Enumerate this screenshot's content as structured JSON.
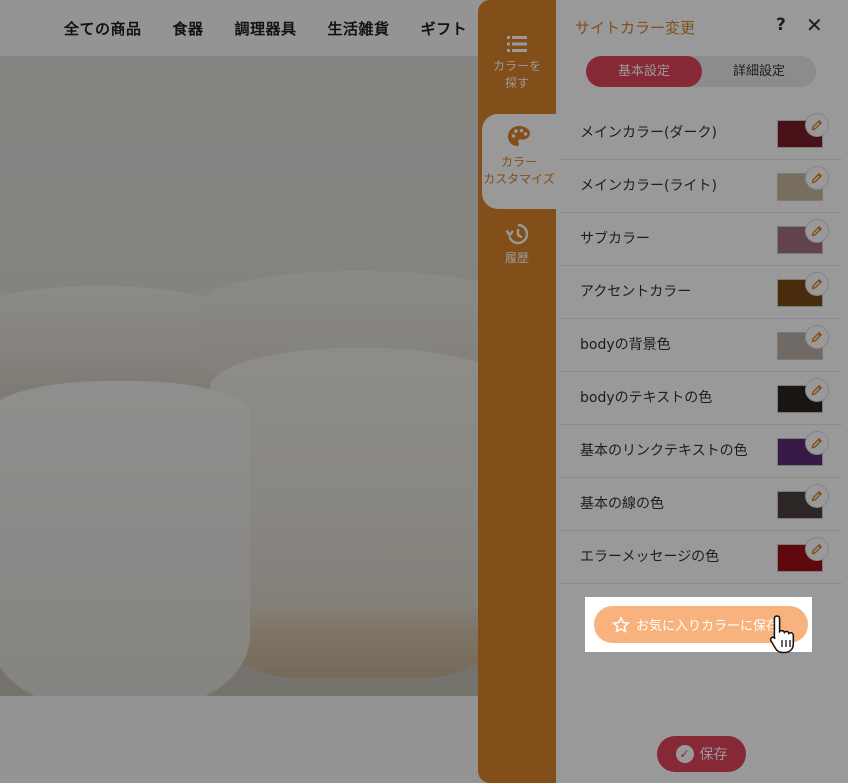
{
  "site": {
    "nav": [
      "全ての商品",
      "食器",
      "調理器具",
      "生活雑貨",
      "ギフト"
    ]
  },
  "sidebar": {
    "tabs": [
      {
        "label_line1": "カラーを",
        "label_line2": "探す",
        "icon": "list-icon"
      },
      {
        "label_line1": "カラー",
        "label_line2": "カスタマイズ",
        "icon": "palette-icon"
      },
      {
        "label_line1": "履歴",
        "label_line2": "",
        "icon": "history-icon"
      }
    ]
  },
  "panel": {
    "title": "サイトカラー変更",
    "help": "?",
    "close": "✕",
    "tabs": {
      "basic": "基本設定",
      "detail": "詳細設定"
    },
    "colors": [
      {
        "label": "メインカラー(ダーク)",
        "color": "#7a1f2b"
      },
      {
        "label": "メインカラー(ライト)",
        "color": "#c9b8a1"
      },
      {
        "label": "サブカラー",
        "color": "#a36e80"
      },
      {
        "label": "アクセントカラー",
        "color": "#7a4a14"
      },
      {
        "label": "bodyの背景色",
        "color": "#b9b1ab"
      },
      {
        "label": "bodyのテキストの色",
        "color": "#2e241f"
      },
      {
        "label": "基本のリンクテキストの色",
        "color": "#5a2a72"
      },
      {
        "label": "基本の線の色",
        "color": "#4a423c"
      },
      {
        "label": "エラーメッセージの色",
        "color": "#9e1014"
      }
    ],
    "favorite_button": "お気に入りカラーに保存",
    "save_button": "保存"
  },
  "theme": {
    "accent": "#d9822b",
    "primary": "#e0435a",
    "favorite": "#f8b27e"
  }
}
